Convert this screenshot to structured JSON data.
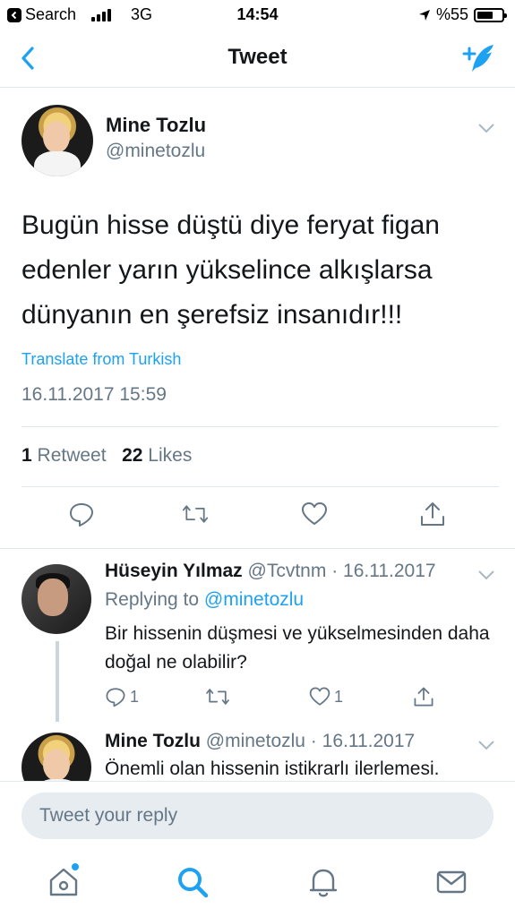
{
  "status_bar": {
    "back_app": "Search",
    "network": "3G",
    "time": "14:54",
    "battery": "%55",
    "battery_level": 0.55
  },
  "nav": {
    "title": "Tweet"
  },
  "tweet": {
    "name": "Mine Tozlu",
    "handle": "@minetozlu",
    "text": "Bugün hisse düştü diye feryat figan edenler yarın yükselince alkışlarsa dünyanın en şerefsiz insanıdır!!!",
    "translate": "Translate from Turkish",
    "timestamp": "16.11.2017 15:59",
    "retweet_count": "1",
    "retweet_label": "Retweet",
    "likes_count": "22",
    "likes_label": "Likes"
  },
  "reply": {
    "name": "Hüseyin Yılmaz",
    "meta": "@Tcvtnm · 16.11.2017",
    "replying_prefix": "Replying to",
    "replying_to": "@minetozlu",
    "text": "Bir hissenin düşmesi ve yükselmesinden daha doğal ne olabilir?",
    "reply_count": "1",
    "like_count": "1"
  },
  "reply2": {
    "name": "Mine Tozlu",
    "meta": "@minetozlu · 16.11.2017",
    "text": "Önemli olan hissenin istikrarlı ilerlemesi."
  },
  "composer": {
    "placeholder": "Tweet your reply"
  },
  "colors": {
    "accent": "#1da1f2",
    "secondary_text": "#657786",
    "divider": "#e1e8ed"
  },
  "icons": [
    "chevron-left-icon",
    "compose-tweet-icon",
    "caret-down-icon",
    "reply-icon",
    "retweet-icon",
    "like-icon",
    "share-icon",
    "home-icon",
    "search-icon",
    "notifications-icon",
    "messages-icon"
  ]
}
